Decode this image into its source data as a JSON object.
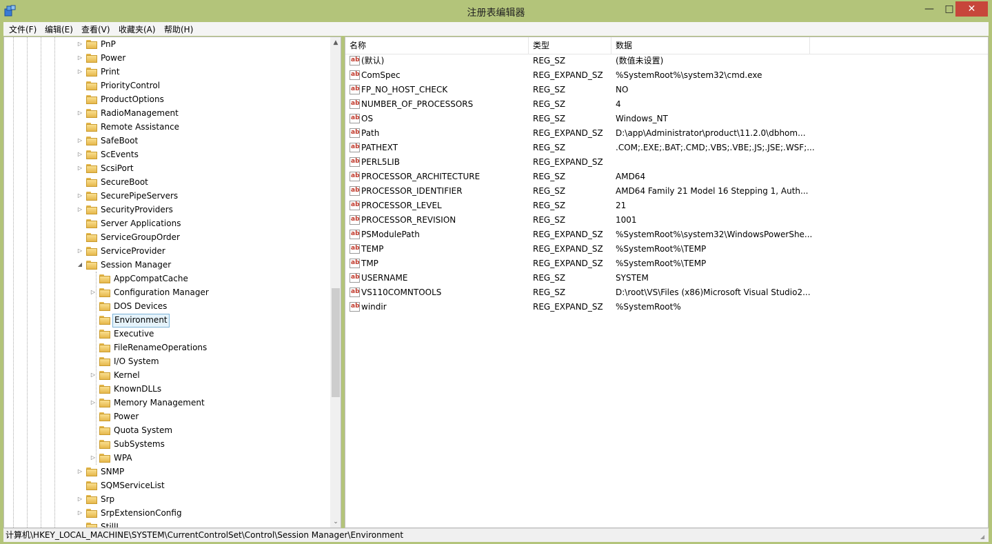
{
  "window": {
    "title": "注册表编辑器",
    "minimize": "—",
    "maximize": "□",
    "close": "✕"
  },
  "menu": [
    "文件(F)",
    "编辑(E)",
    "查看(V)",
    "收藏夹(A)",
    "帮助(H)"
  ],
  "tree": [
    {
      "label": "PnP",
      "level": 1,
      "expander": "▷"
    },
    {
      "label": "Power",
      "level": 1,
      "expander": "▷"
    },
    {
      "label": "Print",
      "level": 1,
      "expander": "▷"
    },
    {
      "label": "PriorityControl",
      "level": 1,
      "expander": ""
    },
    {
      "label": "ProductOptions",
      "level": 1,
      "expander": ""
    },
    {
      "label": "RadioManagement",
      "level": 1,
      "expander": "▷"
    },
    {
      "label": "Remote Assistance",
      "level": 1,
      "expander": ""
    },
    {
      "label": "SafeBoot",
      "level": 1,
      "expander": "▷"
    },
    {
      "label": "ScEvents",
      "level": 1,
      "expander": "▷"
    },
    {
      "label": "ScsiPort",
      "level": 1,
      "expander": "▷"
    },
    {
      "label": "SecureBoot",
      "level": 1,
      "expander": ""
    },
    {
      "label": "SecurePipeServers",
      "level": 1,
      "expander": "▷"
    },
    {
      "label": "SecurityProviders",
      "level": 1,
      "expander": "▷"
    },
    {
      "label": "Server Applications",
      "level": 1,
      "expander": ""
    },
    {
      "label": "ServiceGroupOrder",
      "level": 1,
      "expander": ""
    },
    {
      "label": "ServiceProvider",
      "level": 1,
      "expander": "▷"
    },
    {
      "label": "Session Manager",
      "level": 1,
      "expander": "◢"
    },
    {
      "label": "AppCompatCache",
      "level": 2,
      "expander": ""
    },
    {
      "label": "Configuration Manager",
      "level": 2,
      "expander": "▷"
    },
    {
      "label": "DOS Devices",
      "level": 2,
      "expander": ""
    },
    {
      "label": "Environment",
      "level": 2,
      "expander": "",
      "selected": true
    },
    {
      "label": "Executive",
      "level": 2,
      "expander": ""
    },
    {
      "label": "FileRenameOperations",
      "level": 2,
      "expander": ""
    },
    {
      "label": "I/O System",
      "level": 2,
      "expander": ""
    },
    {
      "label": "Kernel",
      "level": 2,
      "expander": "▷"
    },
    {
      "label": "KnownDLLs",
      "level": 2,
      "expander": ""
    },
    {
      "label": "Memory Management",
      "level": 2,
      "expander": "▷"
    },
    {
      "label": "Power",
      "level": 2,
      "expander": ""
    },
    {
      "label": "Quota System",
      "level": 2,
      "expander": ""
    },
    {
      "label": "SubSystems",
      "level": 2,
      "expander": ""
    },
    {
      "label": "WPA",
      "level": 2,
      "expander": "▷"
    },
    {
      "label": "SNMP",
      "level": 1,
      "expander": "▷"
    },
    {
      "label": "SQMServiceList",
      "level": 1,
      "expander": ""
    },
    {
      "label": "Srp",
      "level": 1,
      "expander": "▷"
    },
    {
      "label": "SrpExtensionConfig",
      "level": 1,
      "expander": "▷"
    },
    {
      "label": "StillI",
      "level": 1,
      "expander": ""
    }
  ],
  "scroll": {
    "up": "▲",
    "down": "⌄"
  },
  "columns": {
    "name": "名称",
    "type": "类型",
    "data": "数据"
  },
  "value_icon": "ab",
  "values": [
    {
      "name": "(默认)",
      "type": "REG_SZ",
      "data": "(数值未设置)"
    },
    {
      "name": "ComSpec",
      "type": "REG_EXPAND_SZ",
      "data": "%SystemRoot%\\system32\\cmd.exe"
    },
    {
      "name": "FP_NO_HOST_CHECK",
      "type": "REG_SZ",
      "data": "NO"
    },
    {
      "name": "NUMBER_OF_PROCESSORS",
      "type": "REG_SZ",
      "data": "4"
    },
    {
      "name": "OS",
      "type": "REG_SZ",
      "data": "Windows_NT"
    },
    {
      "name": "Path",
      "type": "REG_EXPAND_SZ",
      "data": "D:\\app\\Administrator\\product\\11.2.0\\dbhom..."
    },
    {
      "name": "PATHEXT",
      "type": "REG_SZ",
      "data": ".COM;.EXE;.BAT;.CMD;.VBS;.VBE;.JS;.JSE;.WSF;..."
    },
    {
      "name": "PERL5LIB",
      "type": "REG_EXPAND_SZ",
      "data": ""
    },
    {
      "name": "PROCESSOR_ARCHITECTURE",
      "type": "REG_SZ",
      "data": "AMD64"
    },
    {
      "name": "PROCESSOR_IDENTIFIER",
      "type": "REG_SZ",
      "data": "AMD64 Family 21 Model 16 Stepping 1, Auth..."
    },
    {
      "name": "PROCESSOR_LEVEL",
      "type": "REG_SZ",
      "data": "21"
    },
    {
      "name": "PROCESSOR_REVISION",
      "type": "REG_SZ",
      "data": "1001"
    },
    {
      "name": "PSModulePath",
      "type": "REG_EXPAND_SZ",
      "data": "%SystemRoot%\\system32\\WindowsPowerShe..."
    },
    {
      "name": "TEMP",
      "type": "REG_EXPAND_SZ",
      "data": "%SystemRoot%\\TEMP"
    },
    {
      "name": "TMP",
      "type": "REG_EXPAND_SZ",
      "data": "%SystemRoot%\\TEMP"
    },
    {
      "name": "USERNAME",
      "type": "REG_SZ",
      "data": "SYSTEM"
    },
    {
      "name": "VS110COMNTOOLS",
      "type": "REG_SZ",
      "data": "D:\\root\\VS\\Files (x86)Microsoft Visual Studio2..."
    },
    {
      "name": "windir",
      "type": "REG_EXPAND_SZ",
      "data": "%SystemRoot%"
    }
  ],
  "status": "计算机\\HKEY_LOCAL_MACHINE\\SYSTEM\\CurrentControlSet\\Control\\Session Manager\\Environment"
}
